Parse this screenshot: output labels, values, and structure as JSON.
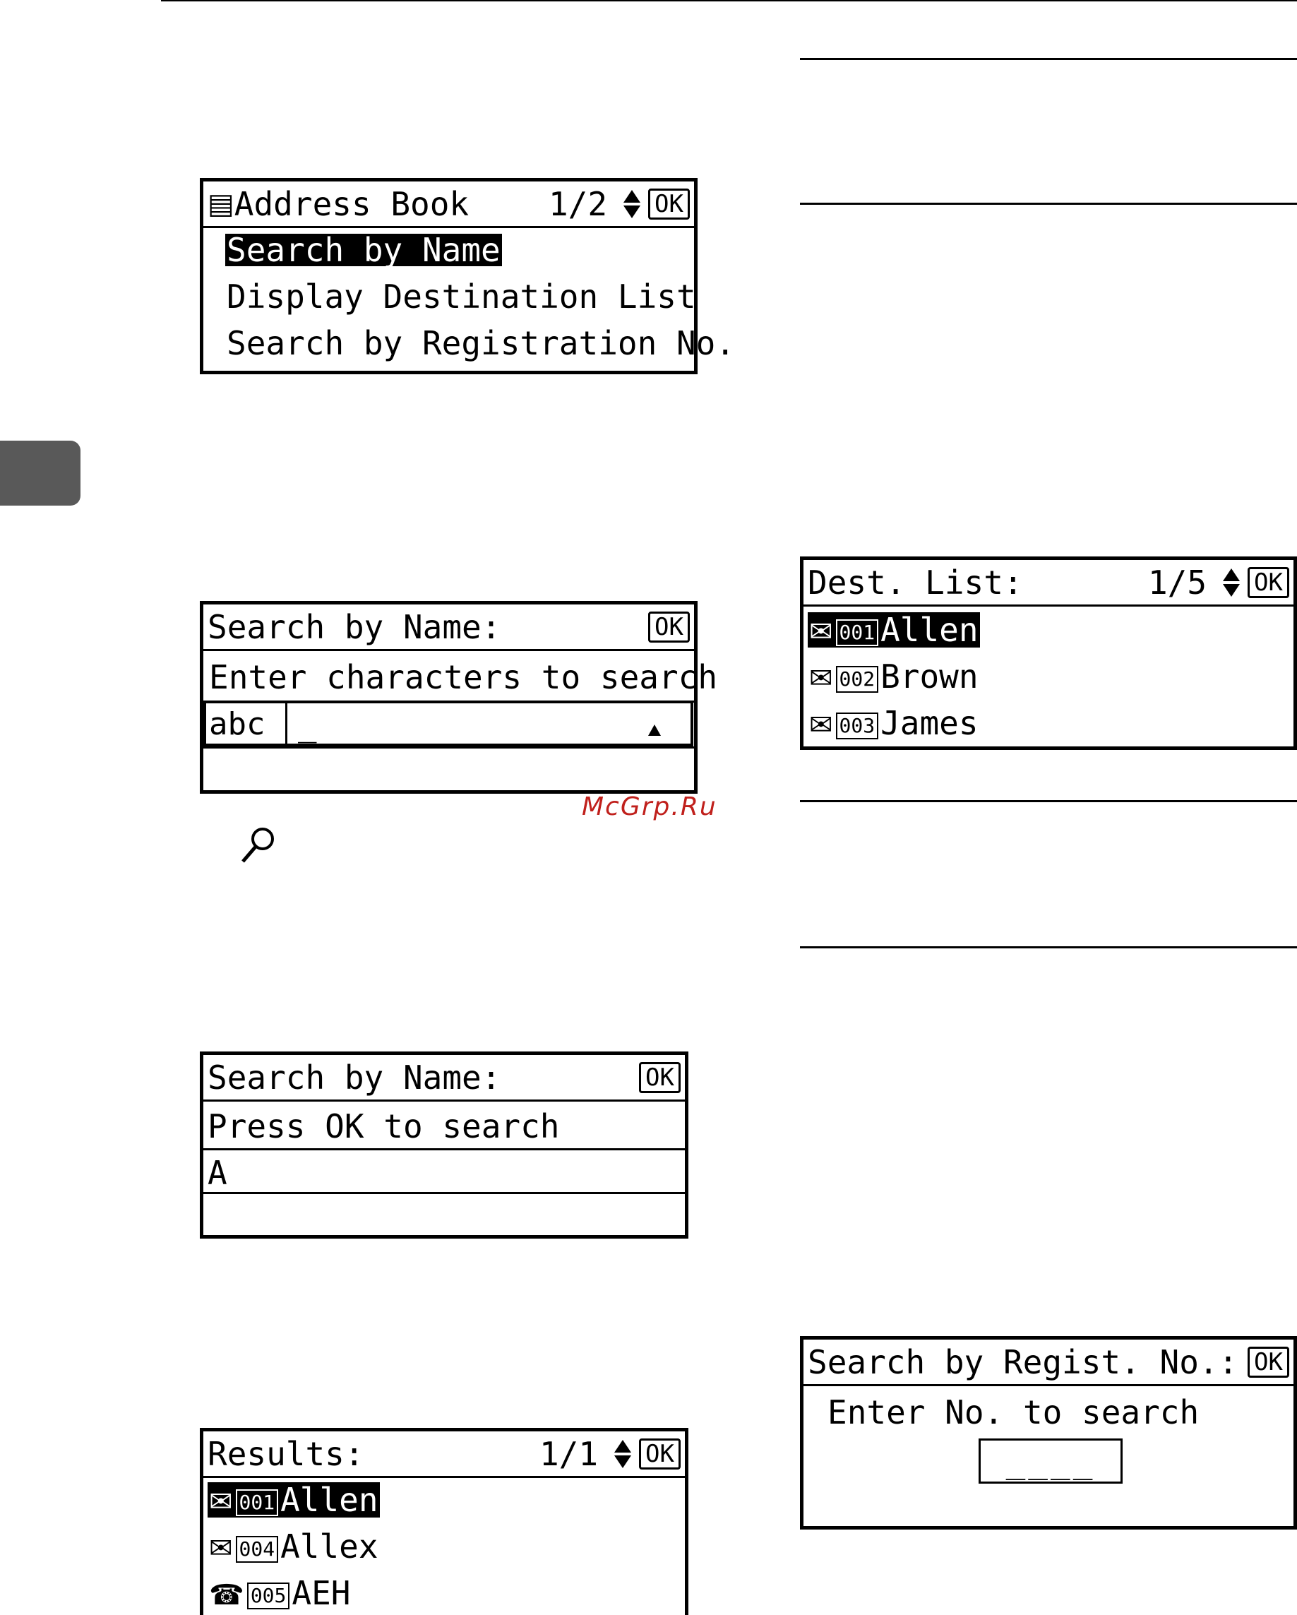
{
  "watermark": "McGrp.Ru",
  "screens": {
    "address_book": {
      "title": "Address Book",
      "page": "1/2",
      "ok": "OK",
      "items": [
        "Search by Name",
        "Display Destination List",
        "Search by Registration No."
      ]
    },
    "search_name_1": {
      "title": "Search by Name:",
      "ok": "OK",
      "prompt": "Enter characters to search",
      "mode": "abc",
      "cursor": "_"
    },
    "search_name_2": {
      "title": "Search by Name:",
      "ok": "OK",
      "prompt": "Press OK to search",
      "value": "A"
    },
    "results": {
      "title": "Results:",
      "page": "1/1",
      "ok": "OK",
      "items": [
        {
          "icon": "address-icon",
          "num": "001",
          "name": "Allen"
        },
        {
          "icon": "address-icon",
          "num": "004",
          "name": "Allex"
        },
        {
          "icon": "phone-icon",
          "num": "005",
          "name": "AEH"
        }
      ]
    },
    "dest_list": {
      "title": "Dest. List:",
      "page": "1/5",
      "ok": "OK",
      "items": [
        {
          "icon": "address-icon",
          "num": "001",
          "name": "Allen"
        },
        {
          "icon": "address-icon",
          "num": "002",
          "name": "Brown"
        },
        {
          "icon": "address-icon",
          "num": "003",
          "name": "James"
        }
      ]
    },
    "search_regist": {
      "title": "Search by Regist. No.:",
      "ok": "OK",
      "prompt": "Enter No. to search",
      "value": "____"
    }
  }
}
